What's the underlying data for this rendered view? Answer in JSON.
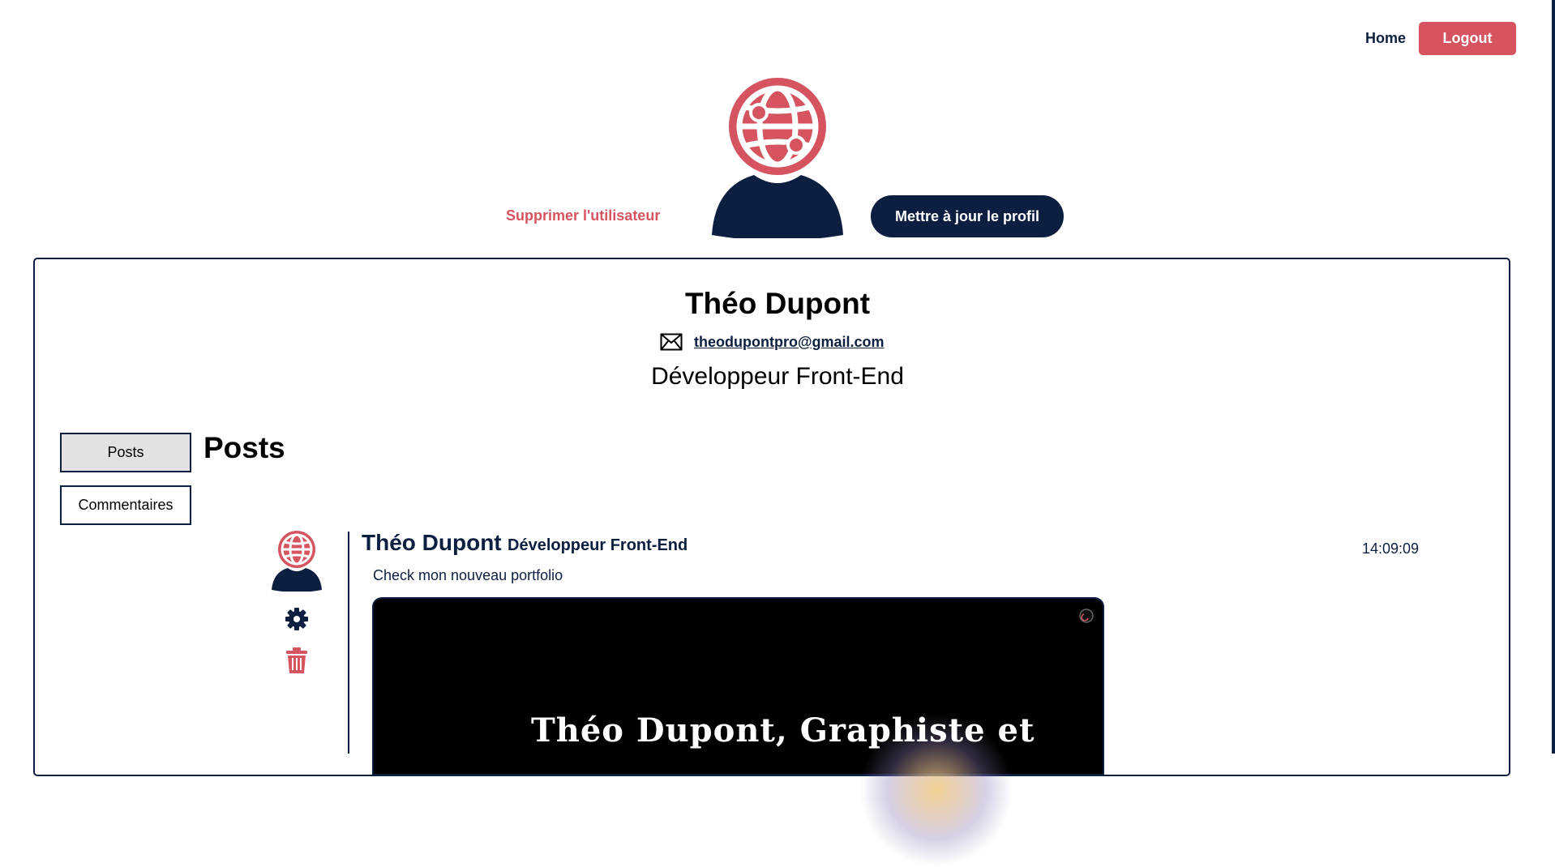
{
  "nav": {
    "home_label": "Home",
    "logout_label": "Logout"
  },
  "profile": {
    "delete_label": "Supprimer l'utilisateur",
    "update_label": "Mettre à jour le profil",
    "name": "Théo Dupont",
    "email": "theodupontpro@gmail.com",
    "job_title": "Développeur Front-End"
  },
  "tabs": [
    {
      "label": "Posts",
      "active": true
    },
    {
      "label": "Commentaires",
      "active": false
    }
  ],
  "section_title": "Posts",
  "post": {
    "author": "Théo Dupont",
    "role": "Développeur Front-End",
    "time": "14:09:09",
    "text": "Check mon nouveau portfolio",
    "image_text": "Théo Dupont, Graphiste et"
  },
  "colors": {
    "navy": "#0d1f40",
    "accent": "#d55460",
    "tab_active_bg": "#e2e2e2"
  },
  "icons": [
    "globe-avatar-icon",
    "mail-icon",
    "settings-icon",
    "trash-icon"
  ]
}
